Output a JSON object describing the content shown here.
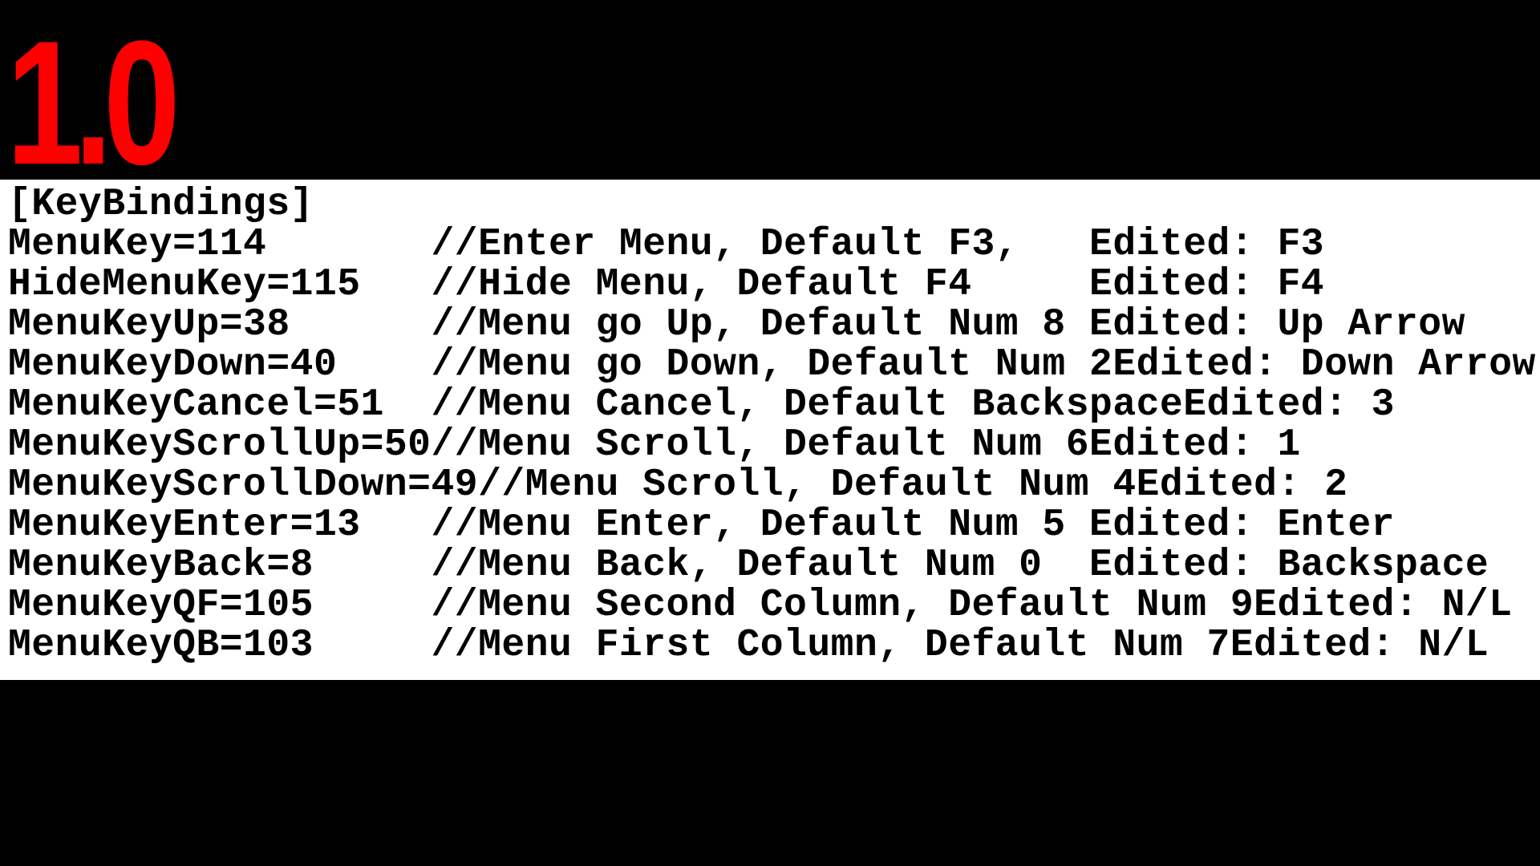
{
  "logo": "1.0",
  "section_header": "[KeyBindings]",
  "columns": {
    "comment_at": 18,
    "edited_at": 46
  },
  "rows": [
    {
      "key": "MenuKey",
      "value": "114",
      "comment": "//Enter Menu, Default F3,",
      "edited": "Edited: F3"
    },
    {
      "key": "HideMenuKey",
      "value": "115",
      "comment": "//Hide Menu, Default F4",
      "edited": "Edited: F4"
    },
    {
      "key": "MenuKeyUp",
      "value": "38",
      "comment": "//Menu go Up, Default Num 8",
      "edited": "Edited: Up Arrow"
    },
    {
      "key": "MenuKeyDown",
      "value": "40",
      "comment": "//Menu go Down, Default Num 2",
      "edited": "Edited: Down Arrow"
    },
    {
      "key": "MenuKeyCancel",
      "value": "51",
      "comment": "//Menu Cancel, Default Backspace",
      "edited": "Edited: 3"
    },
    {
      "key": "MenuKeyScrollUp",
      "value": "50",
      "comment": "//Menu Scroll, Default Num 6",
      "edited": "Edited: 1"
    },
    {
      "key": "MenuKeyScrollDown",
      "value": "49",
      "comment": "//Menu Scroll, Default Num 4",
      "edited": "Edited: 2"
    },
    {
      "key": "MenuKeyEnter",
      "value": "13",
      "comment": "//Menu Enter, Default Num 5",
      "edited": "Edited: Enter"
    },
    {
      "key": "MenuKeyBack",
      "value": "8",
      "comment": "//Menu Back, Default Num 0",
      "edited": "Edited: Backspace"
    },
    {
      "key": "MenuKeyQF",
      "value": "105",
      "comment": "//Menu Second Column, Default Num 9",
      "edited": "Edited: N/L"
    },
    {
      "key": "MenuKeyQB",
      "value": "103",
      "comment": "//Menu First Column, Default Num 7",
      "edited": "Edited: N/L"
    }
  ]
}
